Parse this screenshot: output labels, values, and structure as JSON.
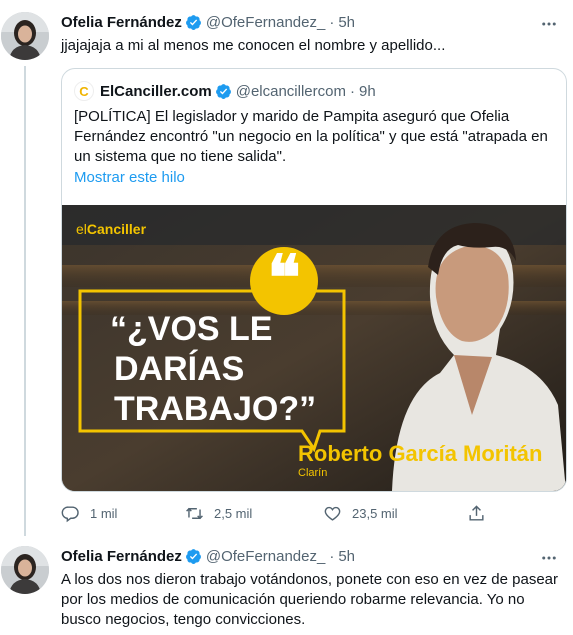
{
  "tweet1": {
    "author_name": "Ofelia Fernández",
    "handle": "@OfeFernandez_",
    "separator": "·",
    "time": "5h",
    "text": "jjajajaja a mi al menos me conocen el nombre y apellido...",
    "quote": {
      "logo_letter": "C",
      "author_name": "ElCanciller.com",
      "handle": "@elcancillercom",
      "separator": "·",
      "time": "9h",
      "text": "[POLÍTICA] El legislador y marido de Pampita aseguró que Ofelia Fernández encontró \"un negocio en la política\" y que está \"atrapada en un sistema que no tiene salida\".",
      "show_thread": "Mostrar este hilo",
      "media": {
        "brand_el": "el",
        "brand_canciller": "Canciller",
        "quote_line1": "“¿VOS LE",
        "quote_line2": "DARÍAS",
        "quote_line3": "TRABAJO?”",
        "person_name": "Roberto García Moritán",
        "source": "Clarín"
      }
    },
    "actions": {
      "replies": "1 mil",
      "retweets": "2,5 mil",
      "likes": "23,5 mil"
    }
  },
  "tweet2": {
    "author_name": "Ofelia Fernández",
    "handle": "@OfeFernandez_",
    "separator": "·",
    "time": "5h",
    "text": "A los dos nos dieron trabajo votándonos, ponete con eso en vez de pasear por los medios de comunicación queriendo robarme relevancia. Yo no busco negocios, tengo convicciones."
  },
  "colors": {
    "text": "#0f1419",
    "secondary": "#536471",
    "link": "#1d9bf0",
    "verified": "#1d9bf0",
    "brand_yellow": "#f3c400"
  }
}
